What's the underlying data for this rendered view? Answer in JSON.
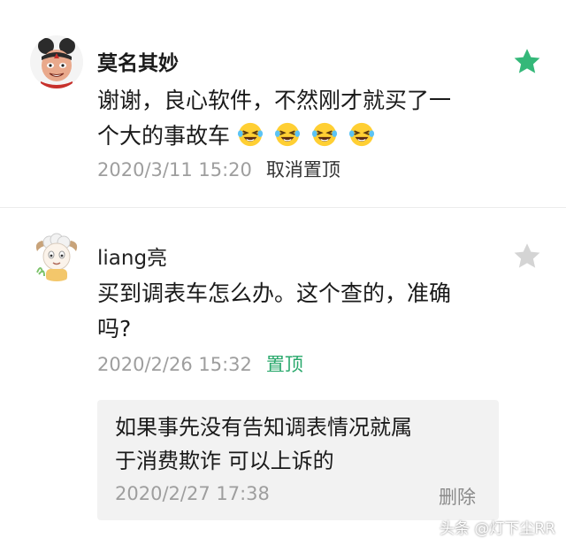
{
  "comments": [
    {
      "username": "莫名其妙",
      "content_line1": "谢谢，良心软件，不然刚才就买了一",
      "content_line2": "个大的事故车",
      "emoji_count": 4,
      "timestamp": "2020/3/11 15:20",
      "pin_action": "取消置顶",
      "starred": true
    },
    {
      "username": "liang亮",
      "content_line1": "买到调表车怎么办。这个查的，准确",
      "content_line2": "吗?",
      "timestamp": "2020/2/26 15:32",
      "pin_action": "置顶",
      "starred": false,
      "reply": {
        "line1": "如果事先没有告知调表情况就属",
        "line2": "于消费欺诈 可以上诉的",
        "timestamp": "2020/2/27 17:38",
        "delete_label": "删除"
      }
    }
  ],
  "watermark": "头条 @灯下尘RR",
  "colors": {
    "star_active": "#34b879",
    "star_inactive": "#cfcfcf",
    "pin_green": "#28a86b",
    "meta_gray": "#9e9e9e",
    "reply_bg": "#f2f2f2"
  },
  "icons": [
    "star-filled-icon",
    "star-outline-icon",
    "laughing-tears-emoji",
    "avatar-nezha",
    "avatar-sheep"
  ]
}
